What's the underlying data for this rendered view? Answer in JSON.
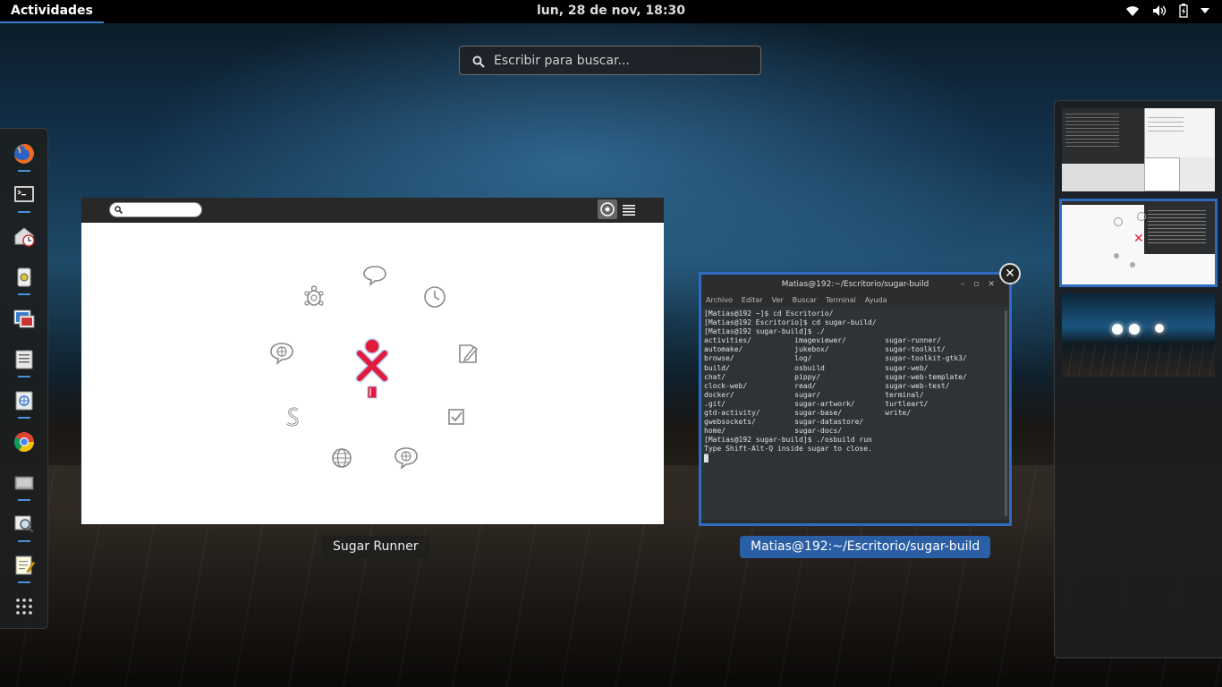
{
  "topbar": {
    "activities_label": "Actividades",
    "clock": "lun, 28 de nov, 18:30"
  },
  "search": {
    "placeholder": "Escribir para buscar..."
  },
  "dash": {
    "apps": [
      "firefox",
      "terminal",
      "mail-clock",
      "usb-drive",
      "image-viewer",
      "files",
      "web-apps",
      "chrome",
      "disk",
      "image-search",
      "text-editor",
      "show-applications"
    ]
  },
  "windows": [
    {
      "caption": "Sugar Runner",
      "active": false
    },
    {
      "caption": "Matias@192:~/Escritorio/sugar-build",
      "active": true
    }
  ],
  "terminal": {
    "title": "Matias@192:~/Escritorio/sugar-build",
    "menu": [
      "Archivo",
      "Editar",
      "Ver",
      "Buscar",
      "Terminal",
      "Ayuda"
    ],
    "content": "[Matias@192 ~]$ cd Escritorio/\n[Matias@192 Escritorio]$ cd sugar-build/\n[Matias@192 sugar-build]$ ./\nactivities/          imageviewer/         sugar-runner/\nautomake/            jukebox/             sugar-toolkit/\nbrowse/              log/                 sugar-toolkit-gtk3/\nbuild/               osbuild              sugar-web/\nchat/                pippy/               sugar-web-template/\nclock-web/           read/                sugar-web-test/\ndocker/              sugar/               terminal/\n.git/                sugar-artwork/       turtleart/\ngtd-activity/        sugar-base/          write/\ngwebsockets/         sugar-datastore/\nhome/                sugar-docs/\n[Matias@192 sugar-build]$ ./osbuild run\nType Shift-Alt-Q inside sugar to close.\n█"
  },
  "workspaces": [
    {
      "name": "workspace-1",
      "active": false
    },
    {
      "name": "workspace-2",
      "active": true
    },
    {
      "name": "workspace-3",
      "active": false
    }
  ]
}
